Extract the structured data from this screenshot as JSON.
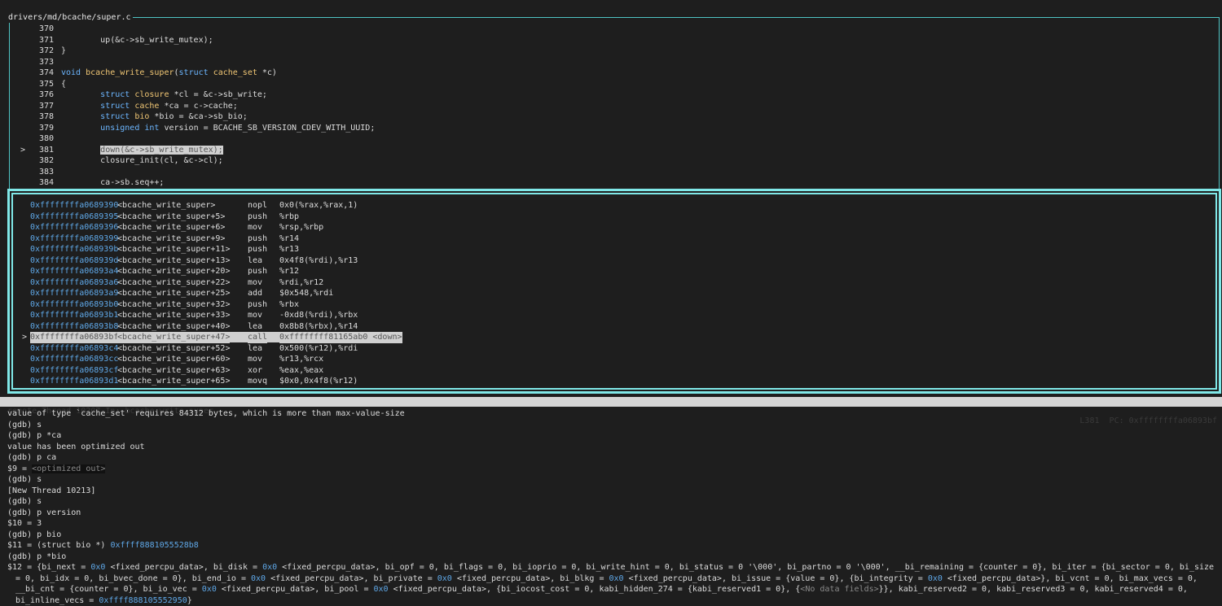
{
  "source": {
    "file_path": "drivers/md/bcache/super.c",
    "lines": [
      {
        "num": "370",
        "code": ""
      },
      {
        "num": "371",
        "code": "        up(&c->sb_write_mutex);"
      },
      {
        "num": "372",
        "code": "}"
      },
      {
        "num": "373",
        "code": ""
      },
      {
        "num": "374",
        "code": "void bcache_write_super(struct cache_set *c)"
      },
      {
        "num": "375",
        "code": "{"
      },
      {
        "num": "376",
        "code": "        struct closure *cl = &c->sb_write;"
      },
      {
        "num": "377",
        "code": "        struct cache *ca = c->cache;"
      },
      {
        "num": "378",
        "code": "        struct bio *bio = &ca->sb_bio;"
      },
      {
        "num": "379",
        "code": "        unsigned int version = BCACHE_SB_VERSION_CDEV_WITH_UUID;"
      },
      {
        "num": "380",
        "code": ""
      },
      {
        "num": "381",
        "code": "        down(&c->sb_write_mutex);",
        "current": true,
        "marker": ">"
      },
      {
        "num": "382",
        "code": "        closure_init(cl, &c->cl);"
      },
      {
        "num": "383",
        "code": ""
      },
      {
        "num": "384",
        "code": "        ca->sb.seq++;"
      }
    ]
  },
  "disassembly": [
    {
      "addr": "0xffffffffa0689390",
      "sym": "<bcache_write_super>",
      "mn": "nopl",
      "op": "0x0(%rax,%rax,1)"
    },
    {
      "addr": "0xffffffffa0689395",
      "sym": "<bcache_write_super+5>",
      "mn": "push",
      "op": "%rbp"
    },
    {
      "addr": "0xffffffffa0689396",
      "sym": "<bcache_write_super+6>",
      "mn": "mov",
      "op": "%rsp,%rbp"
    },
    {
      "addr": "0xffffffffa0689399",
      "sym": "<bcache_write_super+9>",
      "mn": "push",
      "op": "%r14"
    },
    {
      "addr": "0xffffffffa068939b",
      "sym": "<bcache_write_super+11>",
      "mn": "push",
      "op": "%r13"
    },
    {
      "addr": "0xffffffffa068939d",
      "sym": "<bcache_write_super+13>",
      "mn": "lea",
      "op": "0x4f8(%rdi),%r13"
    },
    {
      "addr": "0xffffffffa06893a4",
      "sym": "<bcache_write_super+20>",
      "mn": "push",
      "op": "%r12"
    },
    {
      "addr": "0xffffffffa06893a6",
      "sym": "<bcache_write_super+22>",
      "mn": "mov",
      "op": "%rdi,%r12"
    },
    {
      "addr": "0xffffffffa06893a9",
      "sym": "<bcache_write_super+25>",
      "mn": "add",
      "op": "$0x548,%rdi"
    },
    {
      "addr": "0xffffffffa06893b0",
      "sym": "<bcache_write_super+32>",
      "mn": "push",
      "op": "%rbx"
    },
    {
      "addr": "0xffffffffa06893b1",
      "sym": "<bcache_write_super+33>",
      "mn": "mov",
      "op": "-0xd8(%rdi),%rbx"
    },
    {
      "addr": "0xffffffffa06893b8",
      "sym": "<bcache_write_super+40>",
      "mn": "lea",
      "op": "0x8b8(%rbx),%r14"
    },
    {
      "addr": "0xffffffffa06893bf",
      "sym": "<bcache_write_super+47>",
      "mn": "call",
      "op": "0xffffffff81165ab0 <down>",
      "current": true,
      "marker": ">"
    },
    {
      "addr": "0xffffffffa06893c4",
      "sym": "<bcache_write_super+52>",
      "mn": "lea",
      "op": "0x500(%r12),%rdi"
    },
    {
      "addr": "0xffffffffa06893cc",
      "sym": "<bcache_write_super+60>",
      "mn": "mov",
      "op": "%r13,%rcx"
    },
    {
      "addr": "0xffffffffa06893cf",
      "sym": "<bcache_write_super+63>",
      "mn": "xor",
      "op": "%eax,%eax"
    },
    {
      "addr": "0xffffffffa06893d1",
      "sym": "<bcache_write_super+65>",
      "mn": "movq",
      "op": "$0x0,0x4f8(%r12)"
    }
  ],
  "status_bar": {
    "left": "remote Thread 10207 In: bcache_write_super",
    "line": "L381",
    "pc": "PC: 0xffffffffa06893bf"
  },
  "console": {
    "lines": [
      "value of type `cache_set' requires 84312 bytes, which is more than max-value-size",
      "(gdb) s",
      "(gdb) p *ca",
      "value has been optimized out",
      "(gdb) p ca",
      "$9 = ",
      "(gdb) s",
      "[New Thread 10213]",
      "(gdb) s",
      "(gdb) p version",
      "$10 = 3",
      "(gdb) p bio",
      "$11 = (struct bio *) ",
      "(gdb) p *bio"
    ],
    "optimized_out": "<optimized out>",
    "bio_addr": "0xffff8881055528b8",
    "bio_dump": "$12 = {bi_next = 0x0 <fixed_percpu_data>, bi_disk = 0x0 <fixed_percpu_data>, bi_opf = 0, bi_flags = 0, bi_ioprio = 0, bi_write_hint = 0, bi_status = 0 '\\000', bi_partno = 0 '\\000', __bi_remaining = {counter = 0}, bi_iter = {bi_sector = 0, bi_size = 0, bi_idx = 0, bi_bvec_done = 0}, bi_end_io = 0x0 <fixed_percpu_data>, bi_private = 0x0 <fixed_percpu_data>, bi_blkg = 0x0 <fixed_percpu_data>, bi_issue = {value = 0}, {bi_integrity = 0x0 <fixed_percpu_data>}, bi_vcnt = 0, bi_max_vecs = 0, __bi_cnt = {counter = 0}, bi_io_vec = 0x0 <fixed_percpu_data>, bi_pool = 0x0 <fixed_percpu_data>, {bi_iocost_cost = 0, kabi_hidden_274 = {kabi_reserved1 = 0}, {<No data fields>}}, kabi_reserved2 = 0, kabi_reserved3 = 0, kabi_reserved4 = 0, bi_inline_vecs = 0xffff888105552950}"
  }
}
